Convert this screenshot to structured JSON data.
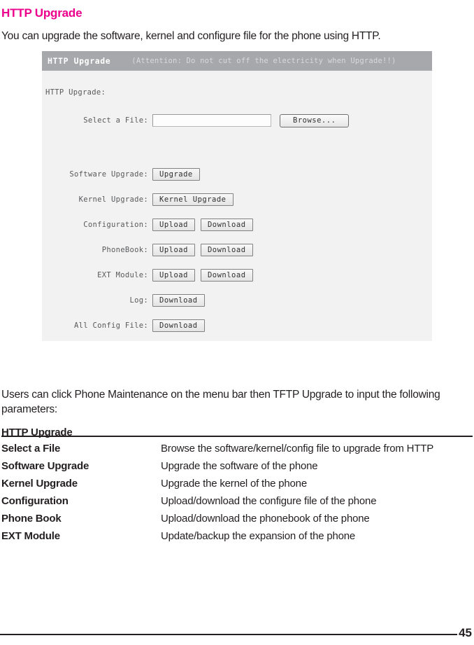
{
  "page": {
    "heading": "HTTP Upgrade",
    "intro": "You can upgrade the software, kernel and configure file for the phone using HTTP.",
    "body_paragraph": "Users can click Phone Maintenance on the menu bar then TFTP Upgrade to input the following parameters:",
    "sub_heading": "HTTP Upgrade",
    "page_number": "45"
  },
  "screenshot": {
    "header": {
      "title": "HTTP Upgrade",
      "attention": "(Attention: Do not cut off the electricity when Upgrade!!)"
    },
    "section_label": "HTTP Upgrade:",
    "select_file": {
      "label": "Select a File:",
      "value": "",
      "placeholder": "",
      "browse_label": "Browse..."
    },
    "rows": [
      {
        "label": "Software Upgrade:",
        "buttons": [
          "Upgrade"
        ]
      },
      {
        "label": "Kernel Upgrade:",
        "buttons": [
          "Kernel Upgrade"
        ]
      },
      {
        "label": "Configuration:",
        "buttons": [
          "Upload",
          "Download"
        ]
      },
      {
        "label": "PhoneBook:",
        "buttons": [
          "Upload",
          "Download"
        ]
      },
      {
        "label": "EXT Module:",
        "buttons": [
          "Upload",
          "Download"
        ]
      },
      {
        "label": "Log:",
        "buttons": [
          "Download"
        ]
      },
      {
        "label": "All Config File:",
        "buttons": [
          "Download"
        ]
      }
    ]
  },
  "definitions": [
    {
      "term": "Select a File",
      "desc": "Browse the software/kernel/config file to upgrade from HTTP"
    },
    {
      "term": "Software Upgrade",
      "desc": "Upgrade the software of the phone"
    },
    {
      "term": "Kernel Upgrade",
      "desc": "Upgrade the kernel of the phone"
    },
    {
      "term": "Configuration",
      "desc": "Upload/download the configure file of the phone"
    },
    {
      "term": "Phone Book",
      "desc": "Upload/download the phonebook of the phone"
    },
    {
      "term": "EXT Module",
      "desc": "Update/backup the expansion of the phone"
    }
  ],
  "colors": {
    "heading_accent": "#ec008c",
    "text": "#231f20",
    "panel_header": "#a6a8ab",
    "panel_body": "#f2f2f2"
  }
}
